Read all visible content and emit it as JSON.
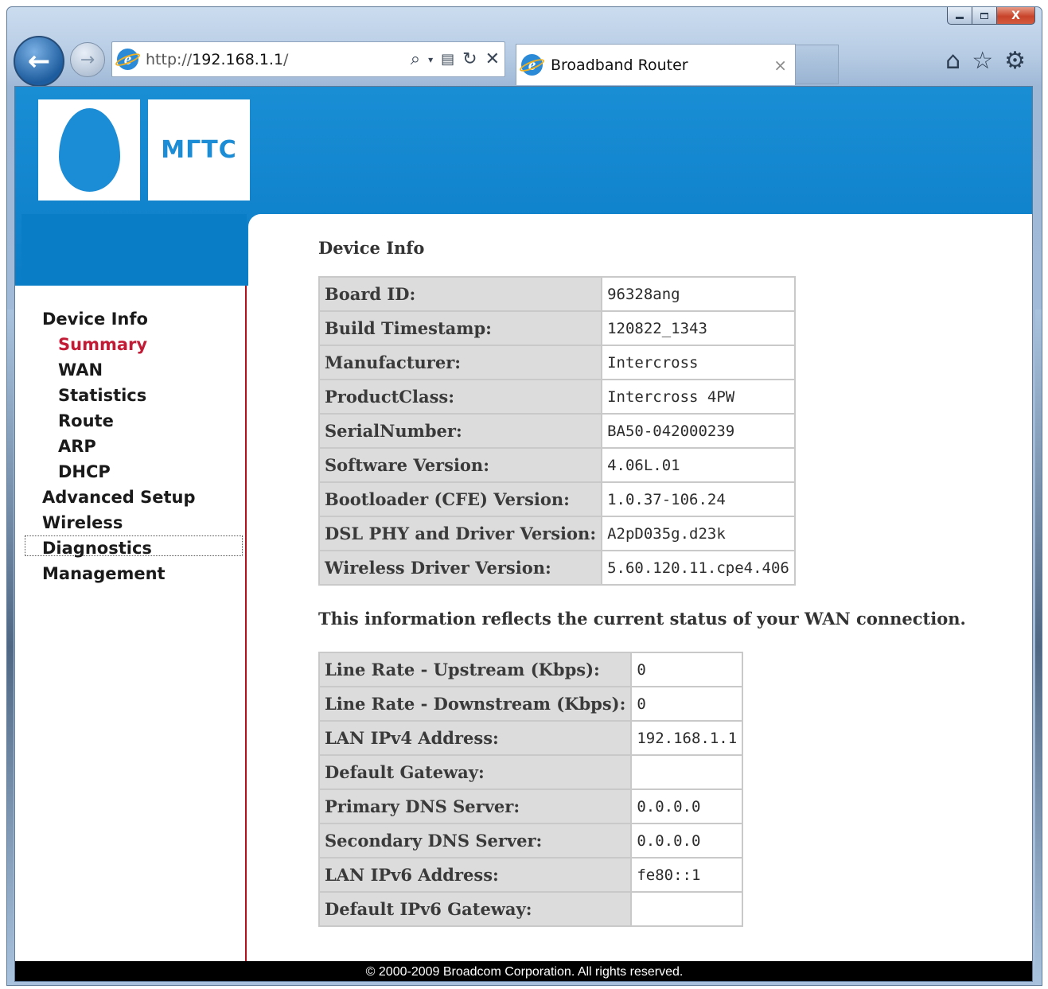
{
  "browser": {
    "address": {
      "prefix": "http://",
      "host": "192.168.1.1",
      "suffix": "/"
    },
    "tab_title": "Broadband Router",
    "tab_close": "×",
    "caption": {
      "close": "X"
    }
  },
  "logo": {
    "text": "МГТС"
  },
  "nav": {
    "items": [
      {
        "label": "Device Info",
        "level": "top"
      },
      {
        "label": "Summary",
        "level": "sub",
        "active": true
      },
      {
        "label": "WAN",
        "level": "sub"
      },
      {
        "label": "Statistics",
        "level": "sub"
      },
      {
        "label": "Route",
        "level": "sub"
      },
      {
        "label": "ARP",
        "level": "sub"
      },
      {
        "label": "DHCP",
        "level": "sub"
      },
      {
        "label": "Advanced Setup",
        "level": "top"
      },
      {
        "label": "Wireless",
        "level": "top"
      },
      {
        "label": "Diagnostics",
        "level": "top"
      },
      {
        "label": "Management",
        "level": "top"
      }
    ]
  },
  "content": {
    "title": "Device Info",
    "device_rows": [
      {
        "key": "Board ID:",
        "value": "96328ang"
      },
      {
        "key": "Build Timestamp:",
        "value": "120822_1343"
      },
      {
        "key": "Manufacturer:",
        "value": "Intercross"
      },
      {
        "key": "ProductClass:",
        "value": "Intercross 4PW"
      },
      {
        "key": "SerialNumber:",
        "value": "BA50-042000239"
      },
      {
        "key": "Software Version:",
        "value": "4.06L.01"
      },
      {
        "key": "Bootloader (CFE) Version:",
        "value": "1.0.37-106.24"
      },
      {
        "key": "DSL PHY and Driver Version:",
        "value": "A2pD035g.d23k"
      },
      {
        "key": "Wireless Driver Version:",
        "value": "5.60.120.11.cpe4.406"
      }
    ],
    "wan_note": "This information reflects the current status of your WAN connection.",
    "wan_rows": [
      {
        "key": "Line Rate - Upstream (Kbps):",
        "value": "0"
      },
      {
        "key": "Line Rate - Downstream (Kbps):",
        "value": "0"
      },
      {
        "key": "LAN IPv4 Address:",
        "value": "192.168.1.1"
      },
      {
        "key": "Default Gateway:",
        "value": ""
      },
      {
        "key": "Primary DNS Server:",
        "value": "0.0.0.0"
      },
      {
        "key": "Secondary DNS Server:",
        "value": "0.0.0.0"
      },
      {
        "key": "LAN IPv6 Address:",
        "value": "fe80::1"
      },
      {
        "key": "Default IPv6 Gateway:",
        "value": ""
      }
    ]
  },
  "footer": {
    "text": "© 2000-2009 Broadcom Corporation. All rights reserved."
  },
  "colors": {
    "brand_blue": "#1b8cd6",
    "nav_active": "#c21b36",
    "nav_border": "#b2121f"
  }
}
